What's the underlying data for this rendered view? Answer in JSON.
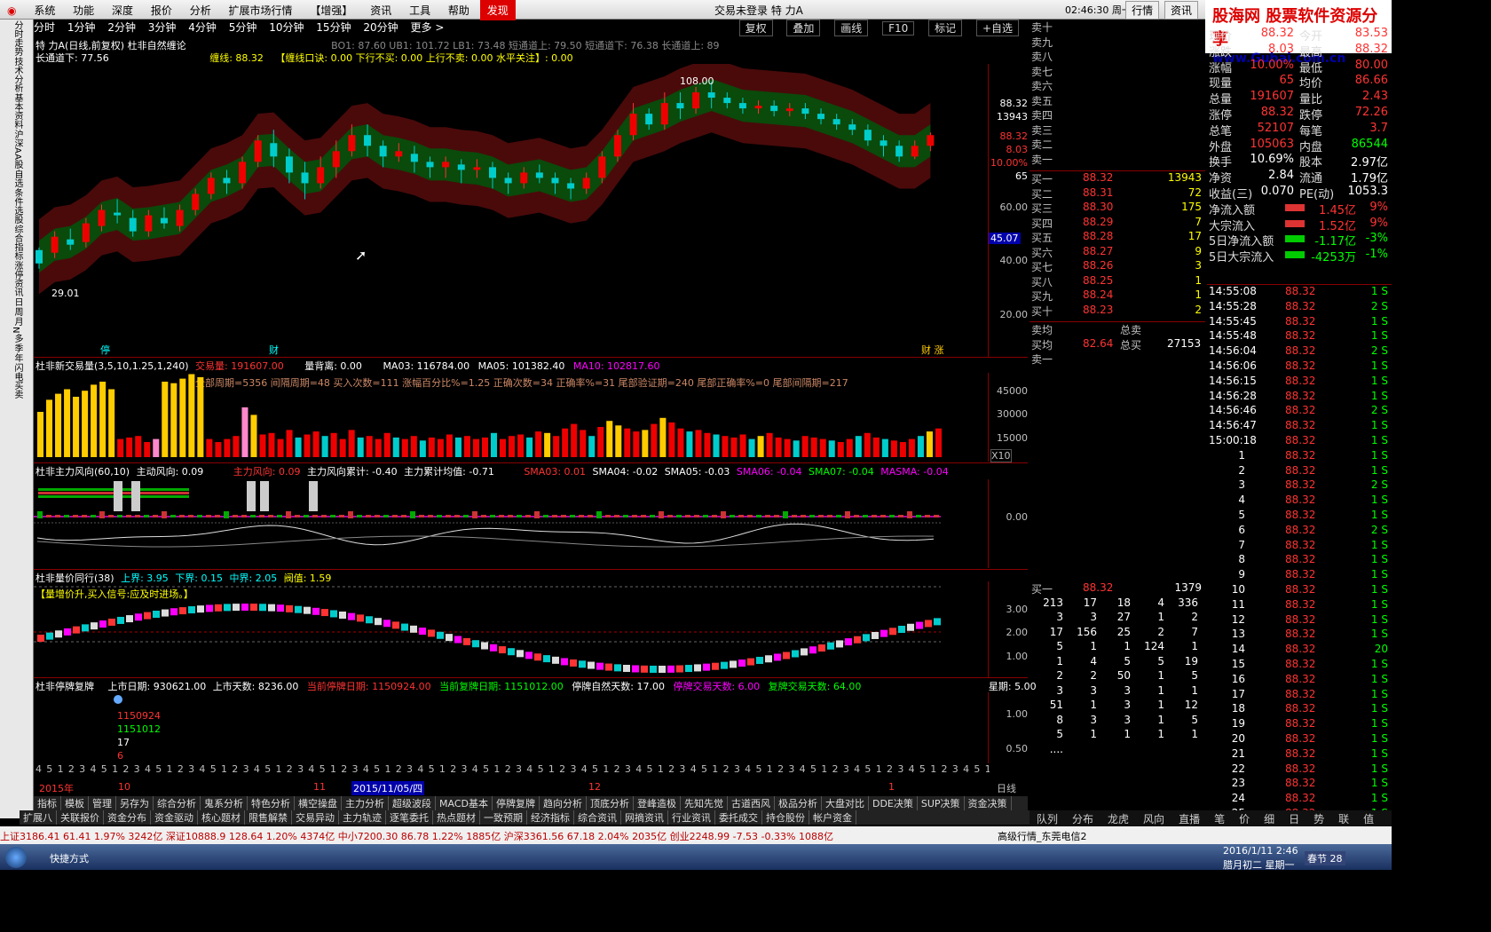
{
  "menu": [
    "系统",
    "功能",
    "深度",
    "报价",
    "分析",
    "扩展市场行情",
    "【增强】",
    "资讯",
    "工具",
    "帮助",
    "发现"
  ],
  "center_title": "交易未登录  特  力A",
  "clock": "02:46:30 周一",
  "right_buttons": [
    "行情",
    "资讯"
  ],
  "logo": {
    "l1": "股海网 股票软件资源分享",
    "l2": "www.Guhai.com.cn"
  },
  "left_vertical": [
    "分时走势",
    "技术分析",
    "基本资料",
    "沪深AA股",
    "自选",
    "条件选股",
    "综合指标",
    "涨停资讯",
    "日",
    "周",
    "月",
    "N",
    "多",
    "季",
    "年",
    "闪电买卖"
  ],
  "timeframes": [
    "分时",
    "1分钟",
    "2分钟",
    "3分钟",
    "4分钟",
    "5分钟",
    "10分钟",
    "15分钟",
    "20分钟",
    "更多 >"
  ],
  "tf_right": [
    "复权",
    "叠加",
    "画线",
    "F10",
    "标记",
    "+自选"
  ],
  "main": {
    "line1": "特 力A(日线,前复权) 杜非自然缠论",
    "line1b": "BO1: 87.60  UB1: 101.72  LB1: 73.48  短通道上: 79.50  短通道下: 76.38  长通道上: 89",
    "line2a": "长通道下: 77.56",
    "line2b": "缠线: 88.32",
    "line2c": "【缠线口诀: 0.00 下行不买: 0.00 上行不卖: 0.00 水平关注】: 0.00",
    "high_label": "108.00",
    "low_label": "29.01",
    "axis": [
      "88.32",
      "13943",
      "88.32",
      "8.03",
      "10.00%",
      "65",
      "60.00",
      "45.07",
      "40.00",
      "20.00"
    ],
    "marks": [
      "停",
      "财",
      "财 涨"
    ]
  },
  "vol": {
    "title": "杜非新交易量(3,5,10,1.25,1,240)",
    "v1": "交易量: 191607.00",
    "v2": "量背离: 0.00",
    "ma3": "MA03: 116784.00",
    "ma5": "MA05: 101382.40",
    "ma10": "MA10: 102817.60",
    "stats": "全部周期=5356  间隔周期=48  买入次数=111  涨幅百分比%=1.25  正确次数=34  正确率%=31  尾部验证期=240  尾部正确率%=0  尾部间隔期=217",
    "axis": [
      "45000",
      "30000",
      "15000",
      "X10"
    ],
    "values": [
      30000,
      38000,
      42000,
      45000,
      40000,
      44000,
      48000,
      50000,
      45000,
      12000,
      13000,
      14000,
      10000,
      12000,
      50000,
      49000,
      52000,
      55000,
      53000,
      12000,
      10000,
      12000,
      14000,
      33000,
      28000,
      15000,
      16000,
      12000,
      18000,
      13000,
      15000,
      17000,
      14000,
      16000,
      12000,
      18000,
      13000,
      14000,
      12000,
      16000,
      13000,
      12000,
      14000,
      11000,
      13000,
      12000,
      15000,
      13000,
      14000,
      12000,
      13000,
      16000,
      12000,
      14000,
      15000,
      13000,
      17000,
      16000,
      14000,
      19000,
      22000,
      18000,
      14000,
      20000,
      24000,
      21000,
      19000,
      17000,
      18000,
      22000,
      26000,
      23000,
      19000,
      17000,
      18000,
      16000,
      15000,
      14000,
      13000,
      15000,
      12000,
      14000,
      16000,
      13000,
      12000,
      11000,
      14000,
      13000,
      12000,
      11000,
      10000,
      12000,
      14000,
      16000,
      13000,
      12000,
      11000,
      10000,
      12000,
      14000,
      17000,
      19000
    ],
    "colors": [
      "y",
      "y",
      "y",
      "y",
      "y",
      "y",
      "y",
      "y",
      "y",
      "r",
      "r",
      "r",
      "r",
      "p",
      "y",
      "y",
      "y",
      "y",
      "y",
      "r",
      "r",
      "r",
      "r",
      "p",
      "y",
      "r",
      "r",
      "r",
      "r",
      "c",
      "r",
      "r",
      "c",
      "r",
      "r",
      "r",
      "c",
      "r",
      "r",
      "r",
      "c",
      "r",
      "r",
      "c",
      "r",
      "r",
      "r",
      "c",
      "r",
      "r",
      "r",
      "c",
      "r",
      "r",
      "r",
      "c",
      "r",
      "y",
      "r",
      "r",
      "r",
      "r",
      "c",
      "r",
      "y",
      "y",
      "r",
      "r",
      "y",
      "r",
      "y",
      "r",
      "r",
      "c",
      "r",
      "r",
      "c",
      "r",
      "r",
      "r",
      "c",
      "y",
      "r",
      "r",
      "r",
      "c",
      "r",
      "r",
      "r",
      "c",
      "r",
      "r",
      "c",
      "r",
      "r",
      "c",
      "r",
      "r",
      "r",
      "c",
      "y",
      "r"
    ]
  },
  "force": {
    "title": "杜非主力风向(60,10)",
    "a": "主动风向: 0.09",
    "b": "主力风向: 0.09",
    "c": "主力风向累计: -0.40",
    "d": "主力累计均值: -0.71",
    "e": "SMA03: 0.01",
    "f": "SMA04: -0.02",
    "g": "SMA05: -0.03",
    "h": "SMA06: -0.04",
    "i": "SMA07: -0.04",
    "j": "MASMA: -0.04",
    "axis": "0.00"
  },
  "pv": {
    "title": "杜非量价同行(38)",
    "a": "上界: 3.95",
    "b": "下界: 0.15",
    "c": "中界: 2.05",
    "d": "阀值: 1.59",
    "msg": "【量增价升,买入信号:应及时进场。】",
    "axis": [
      "3.00",
      "2.00",
      "1.00"
    ]
  },
  "halt": {
    "title": "杜非停牌复牌",
    "a": "上市日期: 930621.00",
    "b": "上市天数: 8236.00",
    "c": "当前停牌日期: 1150924.00",
    "d": "当前复牌日期: 1151012.00",
    "e": "停牌自然天数: 17.00",
    "f": "停牌交易天数: 6.00",
    "g": "复牌交易天数: 64.00",
    "h": "星期: 5.00",
    "l1": "1150924",
    "l2": "1151012",
    "l3": "17",
    "l4": "6",
    "axis": [
      "1.00",
      "0.50"
    ]
  },
  "weekday_row": "4 5 1 2 3 4 5 1 2 3 4 5 1 2 3 4 5 1 2 3 4 5 1 2 3 4 5 1 2 3 4 5 1 2 3 4 5 1 2 3 4 5 1 2 3 4 5 1 2 3 4 5 1 2 3 4 5 1 2 3 4 5 1 2 3 4 5 1 2 3 4 5 1 2 3 4 5 1 2 3 4 5 1 2 3 4 5 1 2 3 4 5 1 2 3 4 5 1 2 3 4 5 1 2 3 4 5",
  "date_row": {
    "a": "2015年",
    "b": "10",
    "c": "11",
    "d": "2015/11/05/四",
    "e": "12",
    "f": "1",
    "g": "日线"
  },
  "bottom_tabs1": [
    "指标",
    "模板",
    "管理",
    "另存为",
    "综合分析",
    "鬼系分析",
    "特色分析",
    "横空操盘",
    "主力分析",
    "超级波段",
    "MACD基本",
    "停牌复牌",
    "趋向分析",
    "顶底分析",
    "登峰造极",
    "先知先觉",
    "古道西风",
    "极品分析",
    "大盘对比",
    "DDE决策",
    "SUP决策",
    "资金决策"
  ],
  "bottom_tabs2": [
    "扩展八",
    "关联报价",
    "资金分布",
    "资金驱动",
    "核心题材",
    "限售解禁",
    "交易异动",
    "主力轨迹",
    "逐笔委托",
    "热点题材",
    "一致预期",
    "经济指标",
    "综合资讯",
    "网摘资讯",
    "行业资讯",
    "委托成交",
    "持仓股份",
    "帐户资金"
  ],
  "sell_labels": [
    "卖十",
    "卖九",
    "卖八",
    "卖七",
    "卖六",
    "卖五",
    "卖四",
    "卖三",
    "卖二",
    "卖一"
  ],
  "buy_rows": [
    [
      "买一",
      "88.32",
      "13943"
    ],
    [
      "买二",
      "88.31",
      "72"
    ],
    [
      "买三",
      "88.30",
      "175"
    ],
    [
      "买四",
      "88.29",
      "7"
    ],
    [
      "买五",
      "88.28",
      "17"
    ],
    [
      "买六",
      "88.27",
      "9"
    ],
    [
      "买七",
      "88.26",
      "3"
    ],
    [
      "买八",
      "88.25",
      "1"
    ],
    [
      "买九",
      "88.24",
      "1"
    ],
    [
      "买十",
      "88.23",
      "2"
    ]
  ],
  "avg": {
    "a": "卖均",
    "b": "总卖",
    "c": "买均",
    "d": "82.64",
    "e": "总买",
    "f": "27153",
    "g": "卖一"
  },
  "queue": {
    "label": "买一",
    "price": "88.32",
    "qty": "1379",
    "rows": [
      [
        "213",
        "17",
        "18",
        "4",
        "336"
      ],
      [
        "3",
        "3",
        "27",
        "1",
        "2"
      ],
      [
        "17",
        "156",
        "25",
        "2",
        "7"
      ],
      [
        "5",
        "1",
        "1",
        "124",
        "1"
      ],
      [
        "1",
        "4",
        "5",
        "5",
        "19"
      ],
      [
        "2",
        "2",
        "50",
        "1",
        "5"
      ],
      [
        "3",
        "3",
        "3",
        "1",
        "1"
      ],
      [
        "51",
        "1",
        "3",
        "1",
        "12"
      ],
      [
        "8",
        "3",
        "3",
        "1",
        "5"
      ],
      [
        "5",
        "1",
        "1",
        "1",
        "1"
      ],
      [
        "....",
        "",
        "",
        "",
        ""
      ]
    ]
  },
  "info": [
    [
      "现价",
      "88.32",
      "今开",
      "83.53"
    ],
    [
      "涨跌",
      "8.03",
      "最高",
      "88.32"
    ],
    [
      "涨幅",
      "10.00%",
      "最低",
      "80.00"
    ],
    [
      "现量",
      "65",
      "均价",
      "86.66"
    ],
    [
      "总量",
      "191607",
      "量比",
      "2.43"
    ],
    [
      "涨停",
      "88.32",
      "跌停",
      "72.26"
    ],
    [
      "总笔",
      "52107",
      "每笔",
      "3.7"
    ],
    [
      "外盘",
      "105063",
      "内盘",
      "86544"
    ],
    [
      "换手",
      "10.69%",
      "股本",
      "2.97亿"
    ],
    [
      "净资",
      "2.84",
      "流通",
      "1.79亿"
    ],
    [
      "收益(三)",
      "0.070",
      "PE(动)",
      "1053.3"
    ]
  ],
  "flows": [
    [
      "净流入额",
      "1.45亿",
      "9%"
    ],
    [
      "大宗流入",
      "1.52亿",
      "9%"
    ],
    [
      "5日净流入额",
      "-1.17亿",
      "-3%"
    ],
    [
      "5日大宗流入",
      "-4253万",
      "-1%"
    ]
  ],
  "ticks": [
    [
      "14:55:08",
      "88.32",
      "1 S"
    ],
    [
      "14:55:28",
      "88.32",
      "2 S"
    ],
    [
      "14:55:45",
      "88.32",
      "1 S"
    ],
    [
      "14:55:48",
      "88.32",
      "1 S"
    ],
    [
      "14:56:04",
      "88.32",
      "2 S"
    ],
    [
      "14:56:06",
      "88.32",
      "1 S"
    ],
    [
      "14:56:15",
      "88.32",
      "1 S"
    ],
    [
      "14:56:28",
      "88.32",
      "1 S"
    ],
    [
      "14:56:46",
      "88.32",
      "2 S"
    ],
    [
      "14:56:47",
      "88.32",
      "1 S"
    ],
    [
      "15:00:18",
      "88.32",
      "1 S"
    ],
    [
      "1",
      "88.32",
      "1 S"
    ],
    [
      "2",
      "88.32",
      "1 S"
    ],
    [
      "3",
      "88.32",
      "2 S"
    ],
    [
      "4",
      "88.32",
      "1 S"
    ],
    [
      "5",
      "88.32",
      "1 S"
    ],
    [
      "6",
      "88.32",
      "2 S"
    ],
    [
      "7",
      "88.32",
      "1 S"
    ],
    [
      "8",
      "88.32",
      "1 S"
    ],
    [
      "9",
      "88.32",
      "1 S"
    ],
    [
      "10",
      "88.32",
      "1 S"
    ],
    [
      "11",
      "88.32",
      "1 S"
    ],
    [
      "12",
      "88.32",
      "1 S"
    ],
    [
      "13",
      "88.32",
      "1 S"
    ],
    [
      "14",
      "88.32",
      "20"
    ],
    [
      "15",
      "88.32",
      "1 S"
    ],
    [
      "16",
      "88.32",
      "1 S"
    ],
    [
      "17",
      "88.32",
      "1 S"
    ],
    [
      "18",
      "88.32",
      "1 S"
    ],
    [
      "19",
      "88.32",
      "1 S"
    ],
    [
      "20",
      "88.32",
      "1 S"
    ],
    [
      "21",
      "88.32",
      "1 S"
    ],
    [
      "22",
      "88.32",
      "1 S"
    ],
    [
      "23",
      "88.32",
      "1 S"
    ],
    [
      "24",
      "88.32",
      "1 S"
    ],
    [
      "25",
      "88.32",
      "1 S"
    ]
  ],
  "right_tabs": [
    "队列",
    "分布",
    "龙虎",
    "风向",
    "直播",
    "笔",
    "价",
    "细",
    "日",
    "势",
    "联",
    "值"
  ],
  "status": "上证3186.41  61.41  1.97%  3242亿  深证10888.9  128.64  1.20%  4374亿  中小7200.30  86.78  1.22%  1885亿  沪深3361.56  67.18  2.04%  2035亿  创业2248.99  -7.53  -0.33%  1088亿",
  "status_right": "高级行情_东莞电信2",
  "taskbar": {
    "a": "快捷方式",
    "b": "春节 28",
    "c": "2016/1/11 2:46",
    "d": "腊月初二 星期一"
  },
  "candles": [
    [
      40,
      45,
      38,
      46,
      "g"
    ],
    [
      44,
      50,
      42,
      52,
      "r"
    ],
    [
      49,
      47,
      45,
      53,
      "g"
    ],
    [
      48,
      55,
      46,
      57,
      "r"
    ],
    [
      54,
      60,
      52,
      62,
      "r"
    ],
    [
      59,
      58,
      55,
      64,
      "g"
    ],
    [
      57,
      52,
      50,
      60,
      "g"
    ],
    [
      52,
      58,
      50,
      60,
      "r"
    ],
    [
      57,
      55,
      53,
      61,
      "g"
    ],
    [
      54,
      60,
      52,
      62,
      "r"
    ],
    [
      60,
      66,
      58,
      68,
      "r"
    ],
    [
      66,
      72,
      64,
      74,
      "r"
    ],
    [
      72,
      70,
      66,
      75,
      "g"
    ],
    [
      70,
      78,
      68,
      80,
      "r"
    ],
    [
      78,
      86,
      76,
      88,
      "r"
    ],
    [
      85,
      80,
      76,
      90,
      "g"
    ],
    [
      80,
      74,
      70,
      83,
      "g"
    ],
    [
      74,
      70,
      64,
      78,
      "g"
    ],
    [
      70,
      76,
      68,
      80,
      "r"
    ],
    [
      76,
      82,
      72,
      86,
      "r"
    ],
    [
      82,
      88,
      80,
      92,
      "r"
    ],
    [
      88,
      84,
      80,
      92,
      "g"
    ],
    [
      84,
      80,
      76,
      86,
      "g"
    ],
    [
      80,
      82,
      78,
      85,
      "r"
    ],
    [
      81,
      78,
      74,
      84,
      "g"
    ],
    [
      78,
      76,
      72,
      80,
      "g"
    ],
    [
      76,
      78,
      72,
      80,
      "r"
    ],
    [
      77,
      75,
      70,
      79,
      "g"
    ],
    [
      75,
      76,
      72,
      79,
      "r"
    ],
    [
      76,
      72,
      68,
      78,
      "g"
    ],
    [
      72,
      70,
      66,
      74,
      "g"
    ],
    [
      70,
      74,
      68,
      76,
      "r"
    ],
    [
      74,
      72,
      70,
      77,
      "g"
    ],
    [
      72,
      70,
      66,
      74,
      "g"
    ],
    [
      70,
      68,
      64,
      72,
      "g"
    ],
    [
      68,
      72,
      66,
      74,
      "r"
    ],
    [
      72,
      80,
      70,
      82,
      "r"
    ],
    [
      80,
      88,
      78,
      90,
      "r"
    ],
    [
      88,
      96,
      86,
      100,
      "r"
    ],
    [
      96,
      92,
      90,
      98,
      "g"
    ],
    [
      92,
      100,
      90,
      104,
      "r"
    ],
    [
      100,
      98,
      94,
      104,
      "g"
    ],
    [
      98,
      104,
      96,
      106,
      "r"
    ],
    [
      104,
      102,
      98,
      108,
      "g"
    ],
    [
      102,
      100,
      98,
      104,
      "g"
    ],
    [
      100,
      98,
      96,
      102,
      "g"
    ],
    [
      98,
      99,
      96,
      101,
      "r"
    ],
    [
      99,
      97,
      95,
      101,
      "g"
    ],
    [
      97,
      98,
      95,
      100,
      "r"
    ],
    [
      98,
      96,
      94,
      100,
      "g"
    ],
    [
      96,
      94,
      92,
      98,
      "g"
    ],
    [
      94,
      92,
      90,
      96,
      "g"
    ],
    [
      92,
      90,
      88,
      94,
      "g"
    ],
    [
      90,
      86,
      84,
      92,
      "g"
    ],
    [
      86,
      84,
      80,
      88,
      "g"
    ],
    [
      84,
      80,
      78,
      86,
      "g"
    ],
    [
      80,
      84,
      79,
      86,
      "r"
    ],
    [
      84,
      88,
      82,
      89,
      "r"
    ]
  ]
}
